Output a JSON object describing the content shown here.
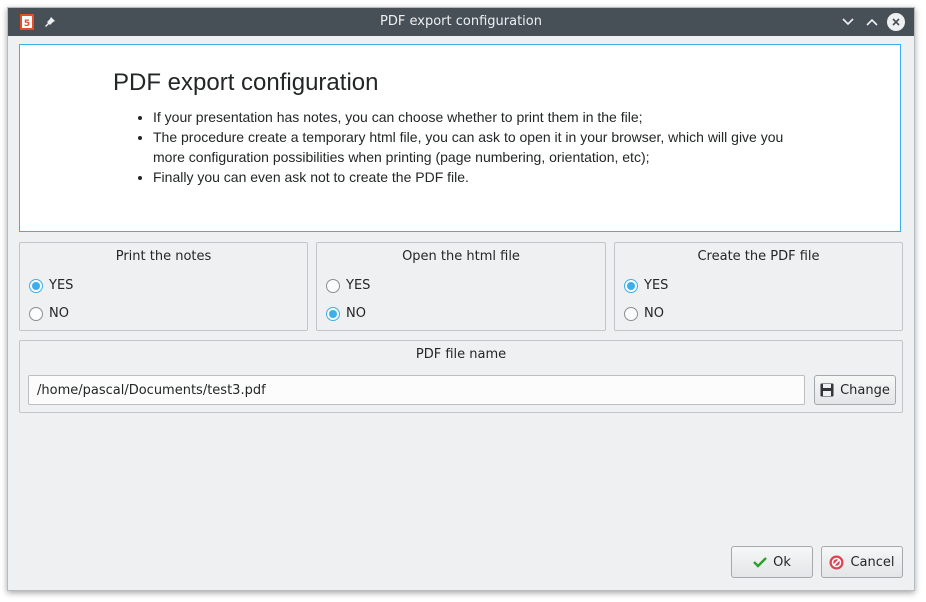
{
  "window": {
    "title": "PDF export configuration"
  },
  "icons": {
    "app": "html5-icon",
    "pin": "pin-icon",
    "minimize": "chevron-down-icon",
    "maximize": "chevron-up-icon",
    "close": "close-icon"
  },
  "info": {
    "heading": "PDF export configuration",
    "bullets": [
      "If your presentation has notes, you can choose whether to print them in the file;",
      "The procedure create a temporary html file, you can ask to open it in your browser, which will give you more configuration possibilities when printing (page numbering, orientation, etc);",
      "Finally you can even ask not to create the PDF file."
    ]
  },
  "groups": {
    "print_notes": {
      "title": "Print the notes",
      "yes": "YES",
      "no": "NO",
      "selected": "YES"
    },
    "open_html": {
      "title": "Open the html file",
      "yes": "YES",
      "no": "NO",
      "selected": "NO"
    },
    "create_pdf": {
      "title": "Create the PDF file",
      "yes": "YES",
      "no": "NO",
      "selected": "YES"
    }
  },
  "file": {
    "title": "PDF file name",
    "path": "/home/pascal/Documents/test3.pdf",
    "change_label": "Change"
  },
  "buttons": {
    "ok": "Ok",
    "cancel": "Cancel"
  },
  "colors": {
    "accent": "#3daee9",
    "titlebar": "#475057",
    "background": "#eff0f1",
    "ok_check": "#2ca02c",
    "cancel_red": "#da4453"
  }
}
